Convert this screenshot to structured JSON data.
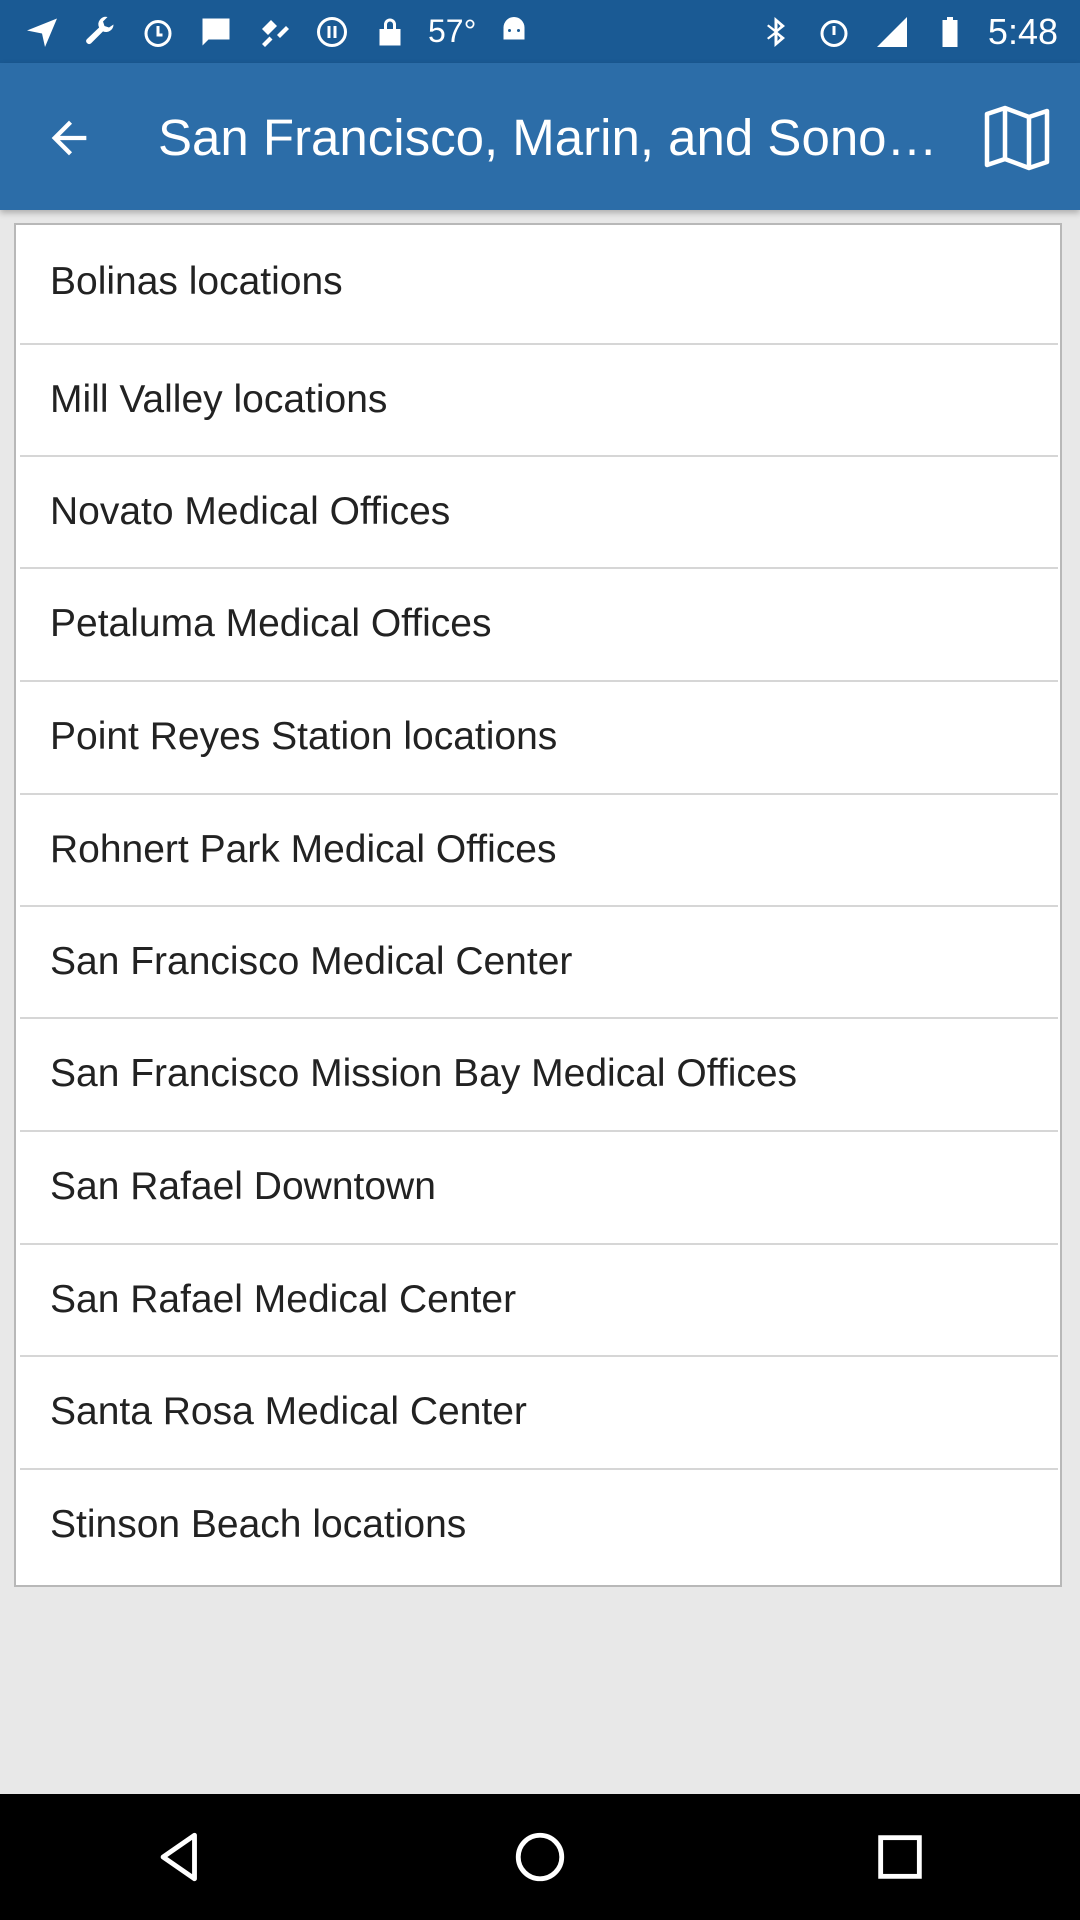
{
  "status_bar": {
    "temperature": "57°",
    "time": "5:48",
    "icons": [
      "navigation-icon",
      "wrench-icon",
      "alarm-icon",
      "message-icon",
      "fake-gps-icon",
      "sync-icon",
      "lock-icon",
      "weather-icon",
      "android-icon",
      "bluetooth-icon",
      "alarm-icon",
      "signal-icon",
      "battery-icon"
    ]
  },
  "app_bar": {
    "title": "San Francisco, Marin, and Sono…",
    "back_icon": "arrow-back-icon",
    "map_icon": "map-icon",
    "colors": {
      "bar": "#2c6da8",
      "status": "#1a5a94"
    }
  },
  "list": {
    "items": [
      "Bolinas locations",
      "Mill Valley locations",
      "Novato Medical Offices",
      "Petaluma Medical Offices",
      "Point Reyes Station locations",
      "Rohnert Park Medical Offices",
      "San Francisco Medical Center",
      "San Francisco Mission Bay Medical Offices",
      "San Rafael Downtown",
      "San Rafael Medical Center",
      "Santa Rosa Medical Center",
      "Stinson Beach locations"
    ]
  },
  "nav_bar": {
    "back": "back-triangle-icon",
    "home": "home-circle-icon",
    "recents": "recents-square-icon"
  }
}
